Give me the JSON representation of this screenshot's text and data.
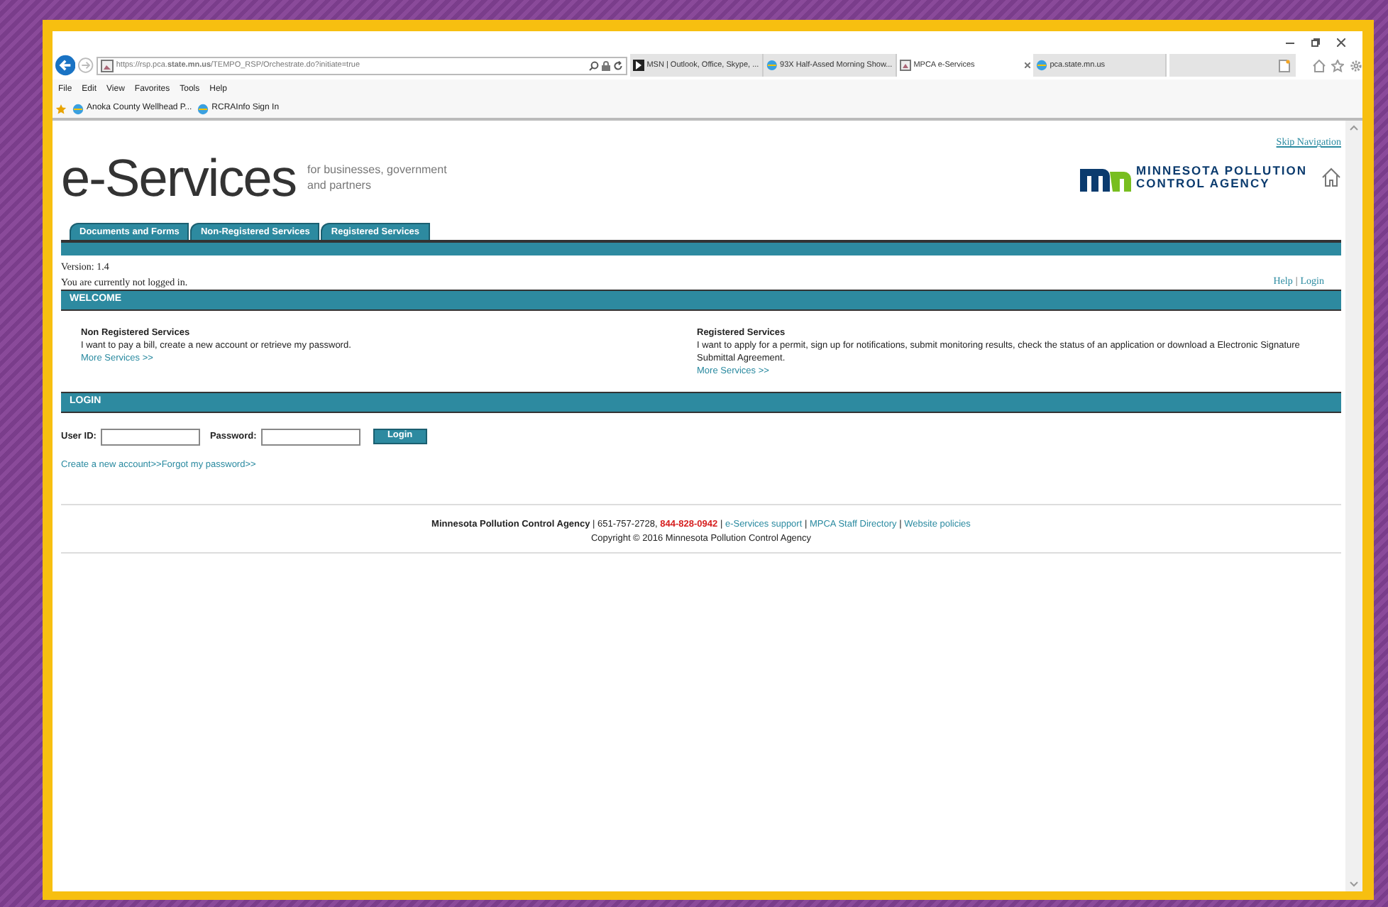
{
  "browser": {
    "address": "https://rsp.pca.**state.mn.us**/TEMPO_RSP/Orchestrate.do?initiate=true",
    "tabs": [
      {
        "title": "MSN | Outlook, Office, Skype, ...",
        "selected": false,
        "kind": "msn"
      },
      {
        "title": "93X Half-Assed Morning Show...",
        "selected": false,
        "kind": "ie"
      },
      {
        "title": "MPCA e-Services",
        "selected": true,
        "kind": "page"
      },
      {
        "title": "pca.state.mn.us",
        "selected": false,
        "kind": "ie"
      }
    ],
    "menu": [
      "File",
      "Edit",
      "View",
      "Favorites",
      "Tools",
      "Help"
    ],
    "favorites": [
      "Anoka County Wellhead P...",
      "RCRAInfo Sign In"
    ]
  },
  "page": {
    "skip_navigation": "Skip Navigation",
    "title": "e-Services",
    "tagline": [
      "for businesses, government",
      "and partners"
    ],
    "logo": [
      "MINNESOTA POLLUTION",
      "CONTROL AGENCY"
    ],
    "tabs": [
      "Documents and Forms",
      "Non-Registered Services",
      "Registered Services"
    ],
    "version": "Version: 1.4",
    "login_status": "You are currently not logged in.",
    "help_links": [
      "Help",
      "Login"
    ],
    "help_separator": "|",
    "welcome": {
      "heading": "WELCOME",
      "columns": [
        {
          "title": "Non Registered Services",
          "text": "I want to pay a bill, create a new account or retrieve my password.",
          "link": "More Services >>"
        },
        {
          "title": "Registered Services",
          "text": "I want to apply for a permit, sign up for notifications, submit monitoring results, check the status of an application or download a Electronic Signature Submittal Agreement.",
          "link": "More Services >>"
        }
      ]
    },
    "login": {
      "heading": "LOGIN",
      "user_label": "User ID:",
      "password_label": "Password:",
      "button": "Login",
      "links": [
        "Create a new account>>",
        "Forgot my password>>"
      ]
    },
    "footer": {
      "org": "Minnesota Pollution Control Agency",
      "phone": " | 651-757-2728, ",
      "hotline": "844-828-0942",
      "separator": " | ",
      "links": [
        "e-Services support",
        "MPCA Staff Directory",
        "Website policies"
      ],
      "copyright": "Copyright © 2016 Minnesota Pollution Control Agency"
    }
  }
}
